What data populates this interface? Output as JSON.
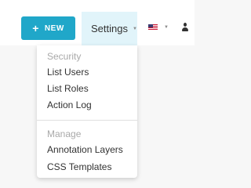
{
  "navbar": {
    "new_button": {
      "label": "NEW",
      "icon": "plus-icon",
      "color": "#20a7c9"
    },
    "settings_menu": {
      "label": "Settings",
      "icon": "caret-down-icon",
      "highlight_color": "#e1f4fa"
    },
    "language": {
      "icon": "us-flag-icon"
    },
    "user": {
      "icon": "user-icon"
    }
  },
  "settings_dropdown": {
    "sections": [
      {
        "header": "Security",
        "items": [
          "List Users",
          "List Roles",
          "Action Log"
        ]
      },
      {
        "header": "Manage",
        "items": [
          "Annotation Layers",
          "CSS Templates"
        ]
      }
    ]
  }
}
